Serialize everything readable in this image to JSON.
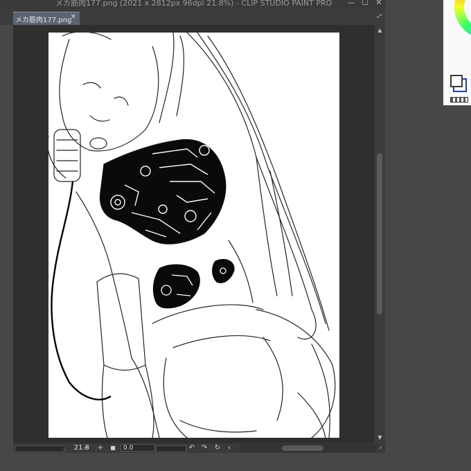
{
  "window": {
    "title": "メカ筋肉177.png (2021 x 2812px 96dpi 21.8%)  - CLIP STUDIO PAINT PRO",
    "minimize_glyph": "—",
    "maximize_glyph": "☐",
    "close_glyph": "✕",
    "panel_toggle_glyph": "⌄"
  },
  "tabs": [
    {
      "label": "メカ筋肉177.png",
      "close_glyph": "✕"
    }
  ],
  "tab_menu_glyph": "⌄",
  "statusbar": {
    "zoom": "21.8",
    "zoom_out_glyph": "−",
    "zoom_in_glyph": "+",
    "fit_glyph": "■",
    "rotation": "0.0",
    "rotate_left_glyph": "↶",
    "rotate_right_glyph": "↷",
    "reset_rotation_glyph": "↻",
    "scroll_left_glyph": "‹",
    "scroll_right_glyph": "›"
  },
  "scrollbar": {
    "up_glyph": "▲",
    "down_glyph": "▼"
  },
  "icons": {
    "canvas": "line-art-illustration",
    "color": "color-wheel-icon",
    "swatch": "drawing-color-swatch-icon"
  },
  "colors": {
    "ui_dark": "#3a3a3a",
    "tab_active": "#5b6473",
    "canvas": "#ffffff",
    "swatch_border": "#1e3ea8"
  }
}
